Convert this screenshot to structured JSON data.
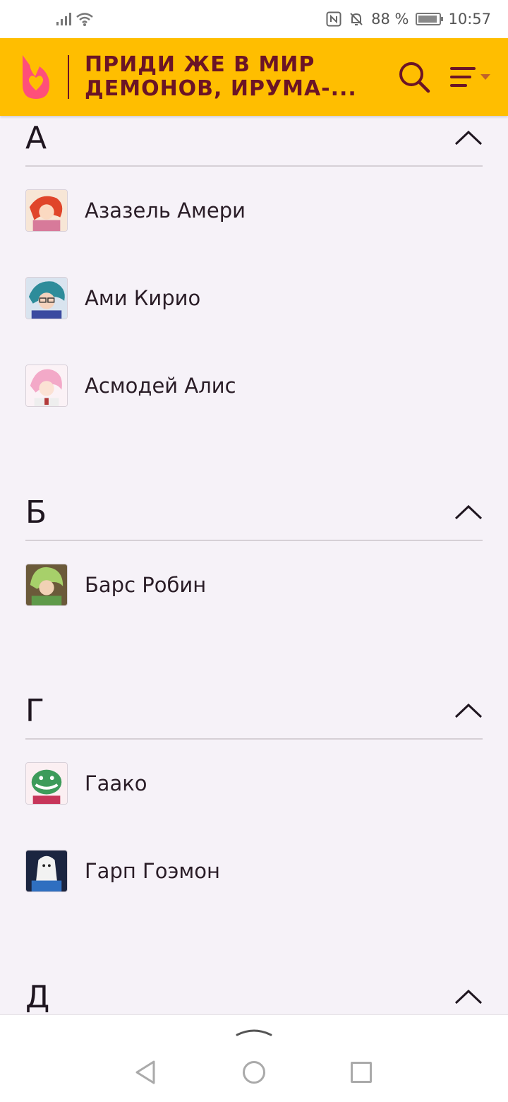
{
  "status_bar": {
    "battery_percent": "88 %",
    "time": "10:57",
    "icons": [
      "signal-icon",
      "wifi-icon",
      "nfc-icon",
      "bell-off-icon",
      "battery-icon"
    ]
  },
  "header": {
    "title_line1": "ПРИДИ ЖЕ В МИР",
    "title_line2": "ДЕМОНОВ, ИРУМА-...",
    "brand_color": "#ffbe00",
    "title_color": "#6b1426",
    "logo_color": "#ff4f7a"
  },
  "sections": [
    {
      "letter": "А",
      "items": [
        {
          "name": "Азазель Амери"
        },
        {
          "name": "Ами Кирио"
        },
        {
          "name": "Асмодей Алис"
        }
      ]
    },
    {
      "letter": "Б",
      "items": [
        {
          "name": "Барс Робин"
        }
      ]
    },
    {
      "letter": "Г",
      "items": [
        {
          "name": "Гаако"
        },
        {
          "name": "Гарп Гоэмон"
        }
      ]
    },
    {
      "letter": "Д",
      "items": []
    }
  ]
}
